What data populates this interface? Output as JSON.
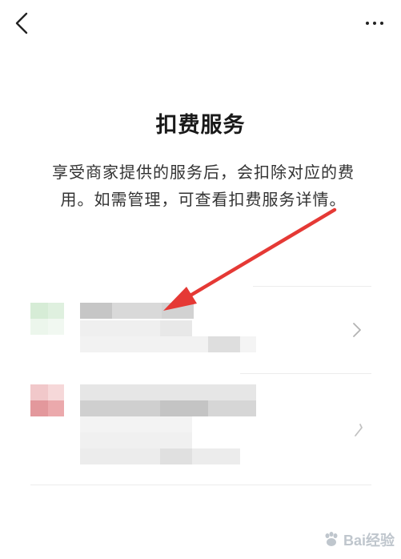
{
  "header": {
    "back_icon": "chevron-left-icon",
    "more_icon": "more-dots-icon"
  },
  "page": {
    "title": "扣费服务",
    "description": "享受商家提供的服务后，会扣除对应的费用。如需管理，可查看扣费服务详情。"
  },
  "services": [
    {
      "id": "service-1",
      "accent": "#cfe8cf",
      "chevron_icon": "chevron-right-icon"
    },
    {
      "id": "service-2",
      "accent": "#e8a4a8",
      "chevron_icon": "chevron-right-icon"
    }
  ],
  "annotation": {
    "color": "#e53935",
    "icon": "arrow-annotation"
  },
  "watermark": {
    "text": "Bai经验",
    "icon": "baidu-paw-icon"
  }
}
